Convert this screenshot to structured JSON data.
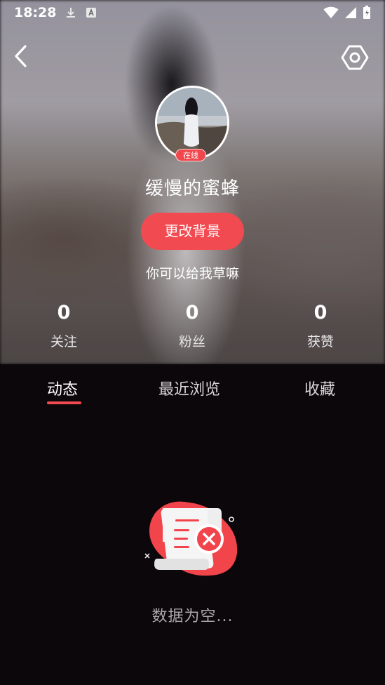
{
  "status_bar": {
    "time": "18:28",
    "left_icons": [
      "download-icon",
      "keyboard-a-icon"
    ],
    "right_icons": [
      "wifi-icon",
      "signal-icon",
      "battery-icon"
    ]
  },
  "nav": {
    "back_icon": "chevron-left-icon",
    "settings_icon": "hexagon-settings-icon"
  },
  "profile": {
    "online_badge": "在线",
    "username": "缓慢的蜜蜂",
    "change_background_label": "更改背景",
    "signature": "你可以给我草嘛"
  },
  "stats": [
    {
      "value": "0",
      "label": "关注"
    },
    {
      "value": "0",
      "label": "粉丝"
    },
    {
      "value": "0",
      "label": "获赞"
    }
  ],
  "tabs": [
    {
      "label": "动态",
      "active": true
    },
    {
      "label": "最近浏览",
      "active": false
    },
    {
      "label": "收藏",
      "active": false
    }
  ],
  "empty_state": {
    "icon": "empty-document-icon",
    "text": "数据为空..."
  },
  "colors": {
    "accent": "#f14a50",
    "background": "#0c070a",
    "muted_text": "#a9a6a8"
  }
}
